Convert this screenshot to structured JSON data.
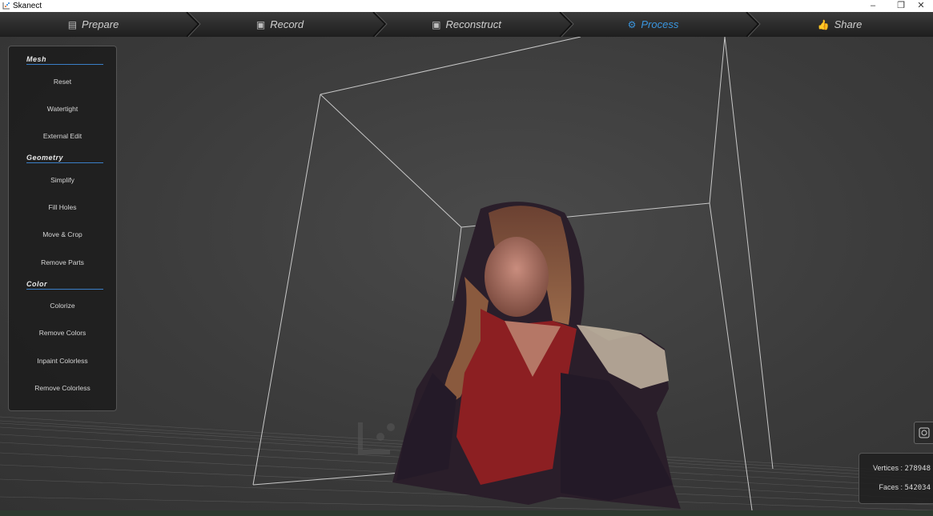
{
  "window": {
    "title": "Skanect"
  },
  "tabs": [
    {
      "label": "Prepare",
      "icon": "prepare-icon"
    },
    {
      "label": "Record",
      "icon": "film-icon"
    },
    {
      "label": "Reconstruct",
      "icon": "film-icon"
    },
    {
      "label": "Process",
      "icon": "gears-icon",
      "active": true
    },
    {
      "label": "Share",
      "icon": "thumbs-up-icon"
    }
  ],
  "panel": {
    "sections": [
      {
        "title": "Mesh",
        "items": [
          "Reset",
          "Watertight",
          "External Edit"
        ]
      },
      {
        "title": "Geometry",
        "items": [
          "Simplify",
          "Fill Holes",
          "Move & Crop",
          "Remove Parts"
        ]
      },
      {
        "title": "Color",
        "items": [
          "Colorize",
          "Remove Colors",
          "Inpaint Colorless",
          "Remove Colorless"
        ]
      }
    ]
  },
  "stats": {
    "vertices_label": "Vertices :",
    "vertices_value": "278948",
    "faces_label": "Faces :",
    "faces_value": "542034"
  },
  "colors": {
    "accent": "#3a95de",
    "tab_text": "#cfcfcf",
    "panel_bg": "#1c1c1c"
  }
}
